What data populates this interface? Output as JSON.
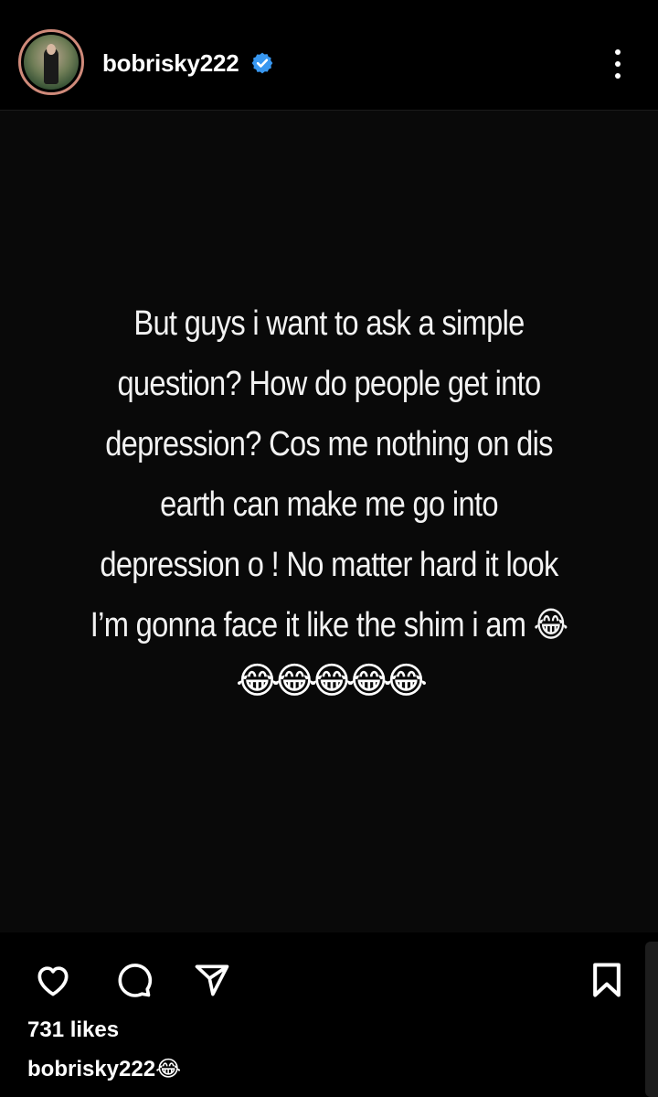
{
  "header": {
    "username": "bobrisky222",
    "verified_icon": "verified-badge-icon",
    "more_icon": "more-vertical-icon",
    "avatar_icon": "profile-avatar"
  },
  "post": {
    "story_lines": [
      "But guys i want to ask a simple",
      "question? How do people get into",
      "depression? Cos me nothing on dis",
      "earth can make me go into",
      "depression o ! No matter hard it look",
      "I’m gonna face it like the shim i am 😂"
    ],
    "emoji_line": "😂😂😂😂😂",
    "background_color": "#090909"
  },
  "actions": {
    "like_icon": "heart-icon",
    "comment_icon": "comment-icon",
    "share_icon": "send-icon",
    "save_icon": "bookmark-icon"
  },
  "likes_text": "731 likes",
  "caption": {
    "username": "bobrisky222",
    "emoji": "😂"
  },
  "colors": {
    "verified": "#3897f0",
    "avatar_ring": "#cf8a7a"
  }
}
